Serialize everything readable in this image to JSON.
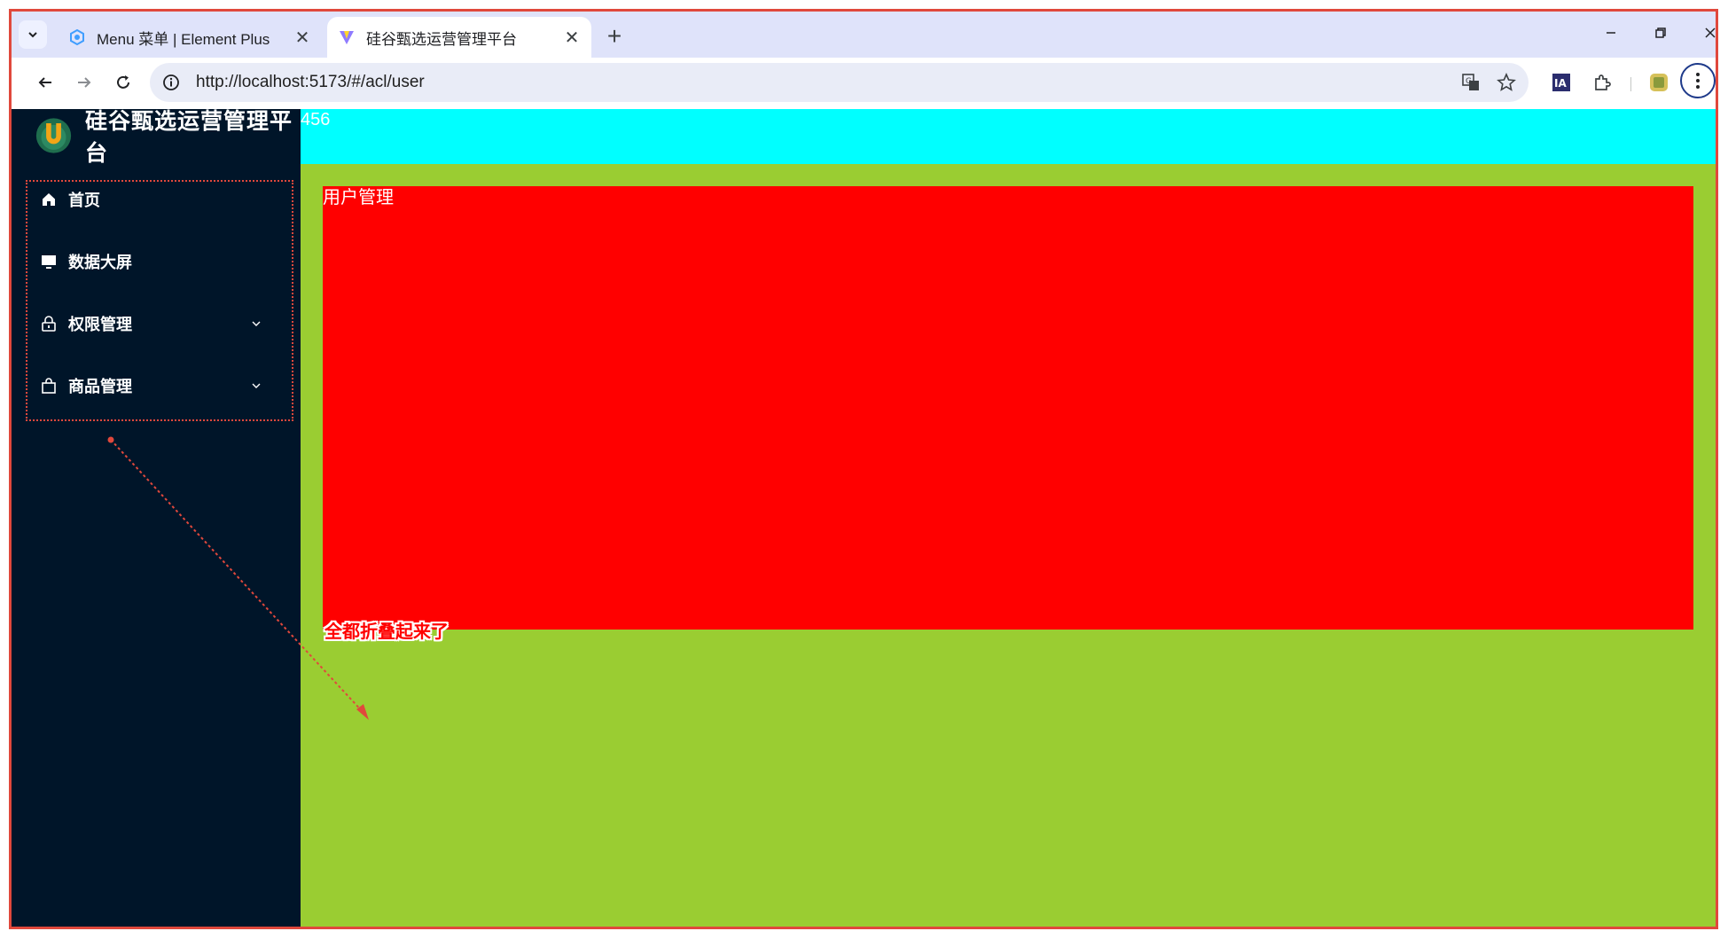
{
  "browser": {
    "tabs": [
      {
        "title": "Menu 菜单 | Element Plus",
        "active": false,
        "favicon": "element-plus-icon"
      },
      {
        "title": "硅谷甄选运营管理平台",
        "active": true,
        "favicon": "vite-icon"
      }
    ],
    "new_tab_label": "+",
    "url": "http://localhost:5173/#/acl/user"
  },
  "app": {
    "logo_title": "硅谷甄选运营管理平台",
    "menu": [
      {
        "label": "首页",
        "icon": "home-icon",
        "has_children": false
      },
      {
        "label": "数据大屏",
        "icon": "monitor-icon",
        "has_children": false
      },
      {
        "label": "权限管理",
        "icon": "lock-icon",
        "has_children": true
      },
      {
        "label": "商品管理",
        "icon": "shopping-bag-icon",
        "has_children": true
      }
    ],
    "header_text": "456",
    "main_text": "用户管理"
  },
  "annotation": {
    "text": "全都折叠起来了"
  },
  "colors": {
    "sidebar_bg": "#001529",
    "header_bg": "#00ffff",
    "main_bg": "#9acd32",
    "panel_bg": "#ff0000",
    "annotation_color": "#e0483c"
  }
}
